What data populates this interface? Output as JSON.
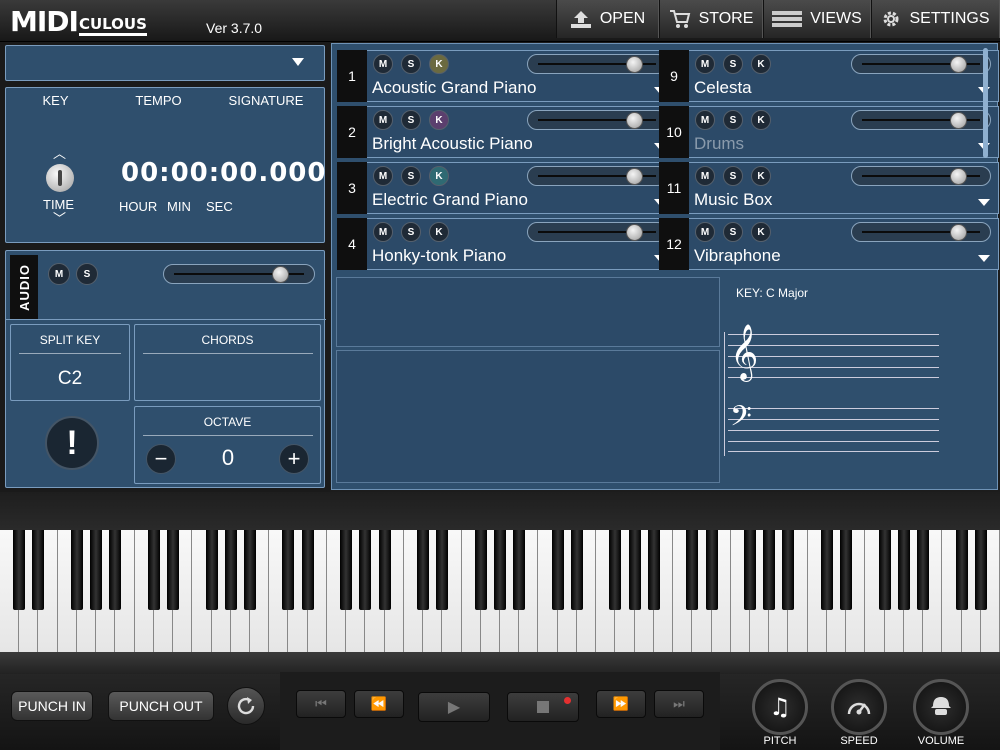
{
  "app": {
    "logo_big": "MIDI",
    "logo_small": "CULOUS",
    "version": "Ver 3.7.0"
  },
  "header": {
    "open": "OPEN",
    "store": "STORE",
    "views": "VIEWS",
    "settings": "SETTINGS"
  },
  "left": {
    "key_label": "KEY",
    "tempo_label": "TEMPO",
    "signature_label": "SIGNATURE",
    "time_label": "TIME",
    "time_value": "00:00:00.000",
    "hour": "HOUR",
    "min": "MIN",
    "sec": "SEC",
    "audio": "AUDIO",
    "m": "M",
    "s": "S",
    "audio_volume": 0.85,
    "split_key_label": "SPLIT KEY",
    "split_key_value": "C2",
    "chords_label": "CHORDS",
    "octave_label": "OCTAVE",
    "octave_value": "0",
    "minus": "−",
    "plus": "+",
    "alert": "!"
  },
  "tracks": [
    {
      "num": "1",
      "name": "Acoustic Grand Piano",
      "m": "M",
      "s": "S",
      "k": "K",
      "volume": 0.85,
      "k_color": "#6b6a40"
    },
    {
      "num": "2",
      "name": "Bright Acoustic Piano",
      "m": "M",
      "s": "S",
      "k": "K",
      "volume": 0.85,
      "k_color": "#5b3f6e"
    },
    {
      "num": "3",
      "name": "Electric Grand Piano",
      "m": "M",
      "s": "S",
      "k": "K",
      "volume": 0.85,
      "k_color": "#2f6a73"
    },
    {
      "num": "4",
      "name": "Honky-tonk Piano",
      "m": "M",
      "s": "S",
      "k": "K",
      "volume": 0.85,
      "k_color": "#1f2a36"
    },
    {
      "num": "9",
      "name": "Celesta",
      "m": "M",
      "s": "S",
      "k": "K",
      "volume": 0.85,
      "k_color": "#1f2a36"
    },
    {
      "num": "10",
      "name": "Drums",
      "m": "M",
      "s": "S",
      "k": "K",
      "volume": 0.85,
      "k_color": "#1f2a36"
    },
    {
      "num": "11",
      "name": "Music Box",
      "m": "M",
      "s": "S",
      "k": "K",
      "volume": 0.85,
      "k_color": "#1f2a36"
    },
    {
      "num": "12",
      "name": "Vibraphone",
      "m": "M",
      "s": "S",
      "k": "K",
      "volume": 0.85,
      "k_color": "#1f2a36"
    }
  ],
  "staff": {
    "key_text": "KEY: C Major",
    "treble": "𝄞",
    "bass": "𝄢"
  },
  "footer": {
    "punch_in": "PUNCH IN",
    "punch_out": "PUNCH OUT",
    "pitch": "PITCH",
    "speed": "SPEED",
    "volume": "VOLUME"
  },
  "colors": {
    "panel": "#2f4f6d",
    "border": "#7a9cbe",
    "record_dot": "#e53030"
  }
}
